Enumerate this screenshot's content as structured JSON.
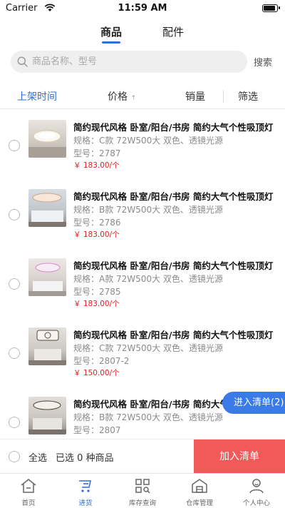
{
  "status_bar": {
    "carrier": "Carrier",
    "time": "11:59 AM"
  },
  "top_tabs": [
    {
      "label": "商品",
      "active": true
    },
    {
      "label": "配件",
      "active": false
    }
  ],
  "search": {
    "placeholder": "商品名称、型号",
    "value": "",
    "button_label": "搜索"
  },
  "sort_bar": {
    "items": [
      {
        "label": "上架时间",
        "active": true
      },
      {
        "label": "价格",
        "active": false,
        "arrow": "⇡"
      },
      {
        "label": "销量",
        "active": false
      },
      {
        "label": "筛选",
        "active": false
      }
    ]
  },
  "products": [
    {
      "name": "简约现代风格  卧室/阳台/书房 简约大气个性吸顶灯",
      "spec": "规格：C款 72W500大 双色、透镜光源",
      "model": "型号：2787",
      "price": "￥ 183.00/个",
      "checked": false
    },
    {
      "name": "简约现代风格  卧室/阳台/书房 简约大气个性吸顶灯",
      "spec": "规格：B款 72W500大 双色、透镜光源",
      "model": "型号：2786",
      "price": "￥ 183.00/个",
      "checked": false
    },
    {
      "name": "简约现代风格  卧室/阳台/书房 简约大气个性吸顶灯",
      "spec": "规格：A款 72W500大 双色、透镜光源",
      "model": "型号：2785",
      "price": "￥ 183.00/个",
      "checked": false
    },
    {
      "name": "简约现代风格  卧室/阳台/书房 简约大气个性吸顶灯",
      "spec": "规格：C款 72W500大 双色、透镜光源",
      "model": "型号：2807-2",
      "price": "￥ 150.00/个",
      "checked": false
    },
    {
      "name": "简约现代风格  卧室/阳台/书房 简约大气个性吸顶灯",
      "spec": "规格：B款 72W500大 双色、透镜光源",
      "model": "型号：2807",
      "price": "",
      "checked": false
    }
  ],
  "float_button": {
    "label": "进入清单(2)"
  },
  "action_bar": {
    "select_all": "全选",
    "selected_text": "已选 0 种商品",
    "add_button": "加入清单"
  },
  "tab_bar": [
    {
      "label": "首页",
      "icon": "home-icon",
      "active": false
    },
    {
      "label": "进货",
      "icon": "cart-icon",
      "active": true
    },
    {
      "label": "库存查询",
      "icon": "inventory-icon",
      "active": false
    },
    {
      "label": "仓库管理",
      "icon": "warehouse-icon",
      "active": false
    },
    {
      "label": "个人中心",
      "icon": "user-icon",
      "active": false
    }
  ],
  "colors": {
    "accent": "#2f6fd8",
    "price": "#e02020",
    "add_button": "#f25a5a",
    "float_button": "#3b7be8"
  }
}
